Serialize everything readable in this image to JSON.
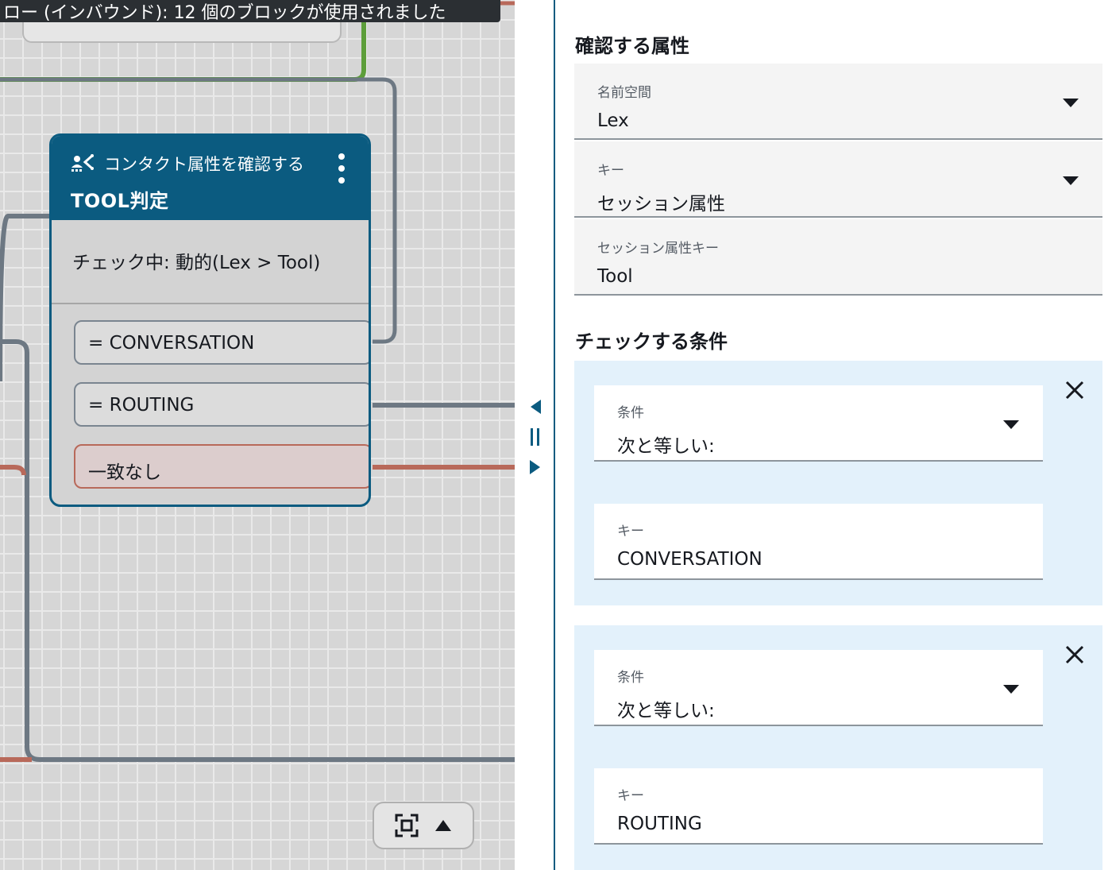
{
  "canvas": {
    "tooltip_text": "ロー (インバウンド): 12 個のブロックが使用されました",
    "block": {
      "type_label": "コンタクト属性を確認する",
      "title": "TOOL判定",
      "checking_text": "チェック中: 動的(Lex > Tool)",
      "branches": [
        "= CONVERSATION",
        "= ROUTING",
        "一致なし"
      ]
    },
    "icons": {
      "block_type": "contact-attribute-icon",
      "menu": "kebab-menu-icon",
      "fit": "fit-to-screen-icon",
      "expand": "caret-up-icon"
    }
  },
  "panel": {
    "attributes_section_title": "確認する属性",
    "namespace": {
      "label": "名前空間",
      "value": "Lex"
    },
    "key": {
      "label": "キー",
      "value": "セッション属性"
    },
    "session_key": {
      "label": "セッション属性キー",
      "value": "Tool"
    },
    "conditions_section_title": "チェックする条件",
    "conditions": [
      {
        "condition_label": "条件",
        "condition_value": "次と等しい:",
        "key_label": "キー",
        "key_value": "CONVERSATION"
      },
      {
        "condition_label": "条件",
        "condition_value": "次と等しい:",
        "key_label": "キー",
        "key_value": "ROUTING"
      }
    ]
  },
  "colors": {
    "block_header": "#0b5b80",
    "connector_gray": "#6d7883",
    "connector_red": "#b8695a",
    "connector_green": "#5d9e3a",
    "condition_card_bg": "#e3f1fb"
  }
}
